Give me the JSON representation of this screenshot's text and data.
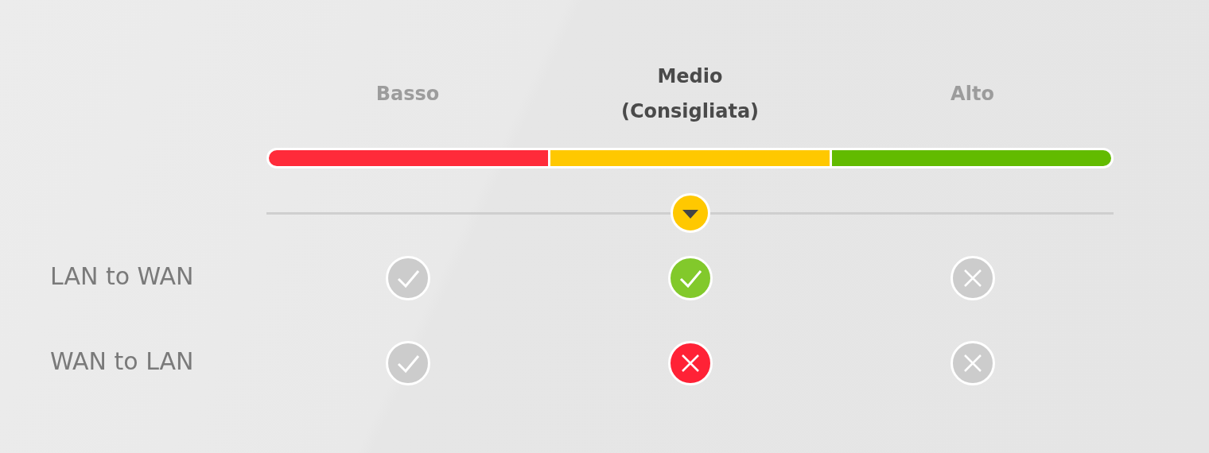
{
  "levels": [
    {
      "label": "Basso",
      "color": "#ff2b3a",
      "selected": false
    },
    {
      "label": "Medio",
      "note": "(Consigliata)",
      "color": "#ffc800",
      "selected": true
    },
    {
      "label": "Alto",
      "color": "#62bb00",
      "selected": false
    }
  ],
  "rows": [
    {
      "label": "LAN to WAN",
      "cells": [
        {
          "allowed": true
        },
        {
          "allowed": true
        },
        {
          "allowed": false
        }
      ]
    },
    {
      "label": "WAN to LAN",
      "cells": [
        {
          "allowed": true
        },
        {
          "allowed": false
        },
        {
          "allowed": false
        }
      ]
    }
  ]
}
